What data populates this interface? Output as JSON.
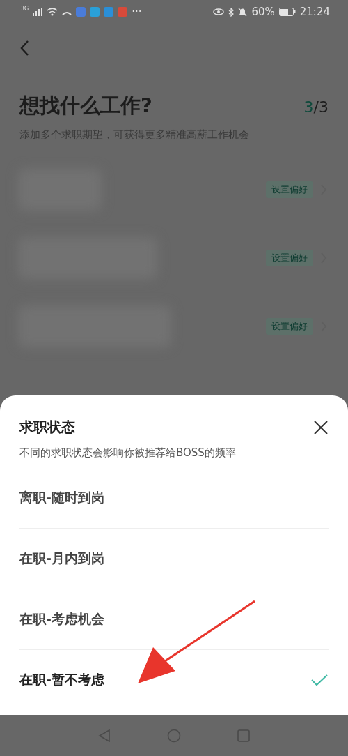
{
  "status_bar": {
    "network": "3G",
    "battery": "60%",
    "time": "21:24",
    "more": "···"
  },
  "header": {
    "title": "想找什么工作?",
    "step_current": "3",
    "step_total": "/3",
    "subtitle": "添加多个求职期望，可获得更多精准高薪工作机会"
  },
  "expectations": [
    {
      "action": "设置偏好"
    },
    {
      "action": "设置偏好"
    },
    {
      "action": "设置偏好"
    }
  ],
  "sheet": {
    "title": "求职状态",
    "subtitle": "不同的求职状态会影响你被推荐给BOSS的频率",
    "options": [
      {
        "label": "离职-随时到岗",
        "selected": false
      },
      {
        "label": "在职-月内到岗",
        "selected": false
      },
      {
        "label": "在职-考虑机会",
        "selected": false
      },
      {
        "label": "在职-暂不考虑",
        "selected": true
      }
    ]
  }
}
